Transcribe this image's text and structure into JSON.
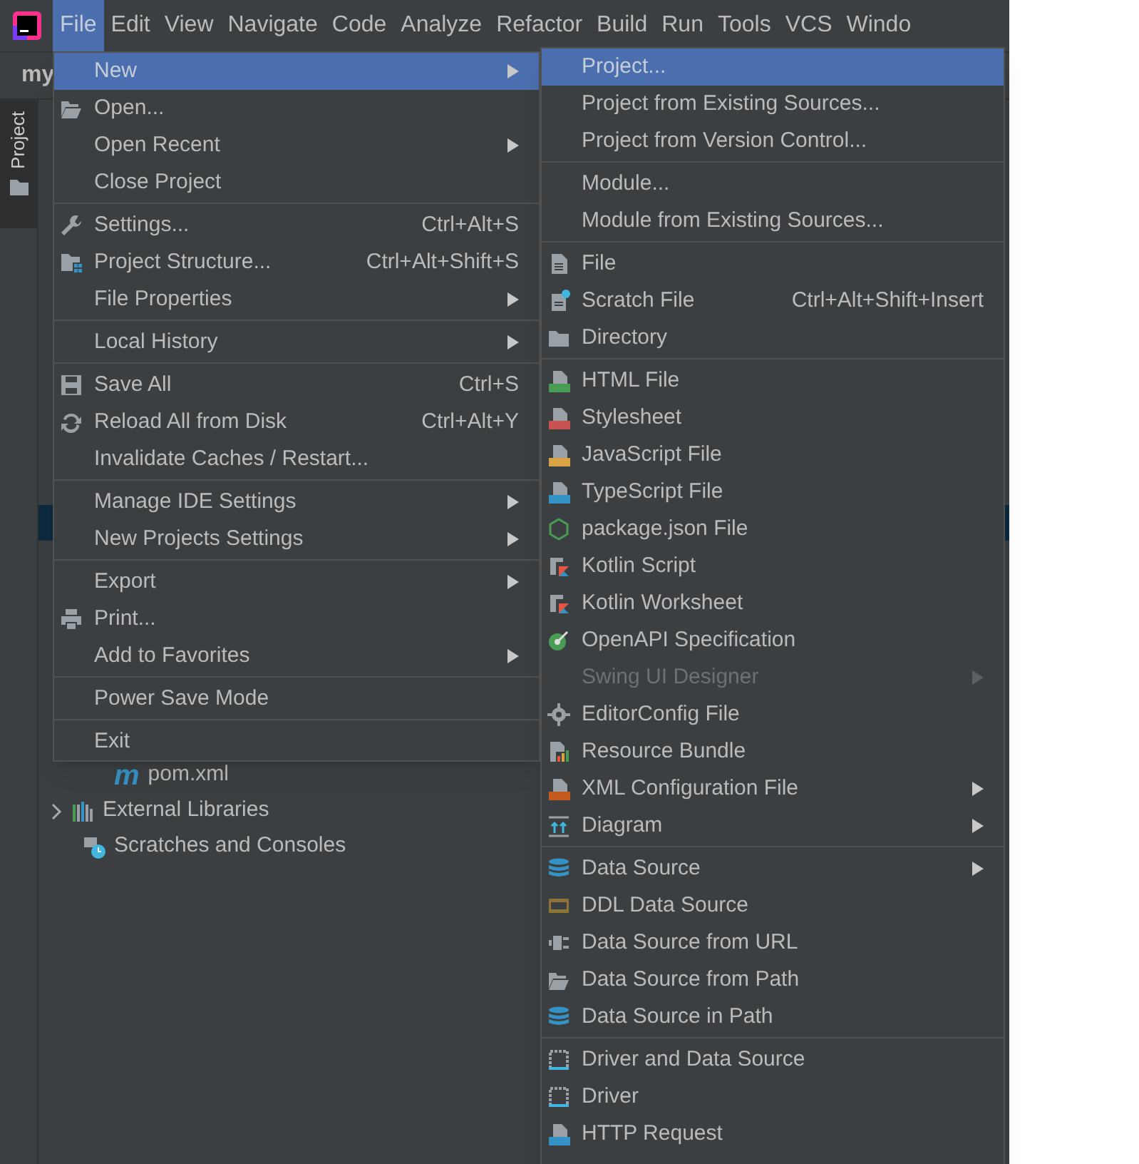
{
  "menubar": [
    {
      "label": "File",
      "selected": true
    },
    {
      "label": "Edit",
      "selected": false
    },
    {
      "label": "View",
      "selected": false
    },
    {
      "label": "Navigate",
      "selected": false
    },
    {
      "label": "Code",
      "selected": false
    },
    {
      "label": "Analyze",
      "selected": false
    },
    {
      "label": "Refactor",
      "selected": false
    },
    {
      "label": "Build",
      "selected": false
    },
    {
      "label": "Run",
      "selected": false
    },
    {
      "label": "Tools",
      "selected": false
    },
    {
      "label": "VCS",
      "selected": false
    },
    {
      "label": "Windo",
      "selected": false
    }
  ],
  "project_title": "my",
  "tool_tab": {
    "label": "Project"
  },
  "tree": [
    {
      "kind": "maven",
      "badge": "m",
      "label": "pom.xml",
      "expandable": false
    },
    {
      "kind": "libraries",
      "label": "External Libraries",
      "expandable": true
    },
    {
      "kind": "scratches",
      "label": "Scratches and Consoles",
      "expandable": false
    }
  ],
  "file_menu": {
    "sections": [
      [
        {
          "kind": "none",
          "label": "New",
          "submenu": true,
          "selected": true
        },
        {
          "kind": "folder-open",
          "label": "Open...",
          "submenu": false,
          "selected": false
        },
        {
          "kind": "none",
          "label": "Open Recent",
          "submenu": true,
          "selected": false
        },
        {
          "kind": "none",
          "label": "Close Project",
          "submenu": false,
          "selected": false
        }
      ],
      [
        {
          "kind": "wrench",
          "label": "Settings...",
          "shortcut": "Ctrl+Alt+S",
          "submenu": false,
          "selected": false
        },
        {
          "kind": "structure",
          "label": "Project Structure...",
          "shortcut": "Ctrl+Alt+Shift+S",
          "submenu": false,
          "selected": false
        },
        {
          "kind": "none",
          "label": "File Properties",
          "submenu": true,
          "selected": false
        }
      ],
      [
        {
          "kind": "none",
          "label": "Local History",
          "submenu": true,
          "selected": false
        }
      ],
      [
        {
          "kind": "save",
          "label": "Save All",
          "shortcut": "Ctrl+S",
          "submenu": false,
          "selected": false
        },
        {
          "kind": "reload",
          "label": "Reload All from Disk",
          "shortcut": "Ctrl+Alt+Y",
          "submenu": false,
          "selected": false
        },
        {
          "kind": "none",
          "label": "Invalidate Caches / Restart...",
          "submenu": false,
          "selected": false
        }
      ],
      [
        {
          "kind": "none",
          "label": "Manage IDE Settings",
          "submenu": true,
          "selected": false
        },
        {
          "kind": "none",
          "label": "New Projects Settings",
          "submenu": true,
          "selected": false
        }
      ],
      [
        {
          "kind": "none",
          "label": "Export",
          "submenu": true,
          "selected": false
        },
        {
          "kind": "printer",
          "label": "Print...",
          "submenu": false,
          "selected": false
        },
        {
          "kind": "none",
          "label": "Add to Favorites",
          "submenu": true,
          "selected": false
        }
      ],
      [
        {
          "kind": "none",
          "label": "Power Save Mode",
          "submenu": false,
          "selected": false
        }
      ],
      [
        {
          "kind": "none",
          "label": "Exit",
          "submenu": false,
          "selected": false
        }
      ]
    ]
  },
  "new_submenu": {
    "sections": [
      [
        {
          "kind": "none",
          "label": "Project...",
          "submenu": false,
          "selected": true,
          "disabled": false
        },
        {
          "kind": "none",
          "label": "Project from Existing Sources...",
          "submenu": false,
          "selected": false,
          "disabled": false
        },
        {
          "kind": "none",
          "label": "Project from Version Control...",
          "submenu": false,
          "selected": false,
          "disabled": false
        }
      ],
      [
        {
          "kind": "none",
          "label": "Module...",
          "submenu": false,
          "selected": false,
          "disabled": false
        },
        {
          "kind": "none",
          "label": "Module from Existing Sources...",
          "submenu": false,
          "selected": false,
          "disabled": false
        }
      ],
      [
        {
          "kind": "file",
          "label": "File",
          "submenu": false,
          "selected": false,
          "disabled": false
        },
        {
          "kind": "scratch",
          "label": "Scratch File",
          "shortcut": "Ctrl+Alt+Shift+Insert",
          "submenu": false,
          "selected": false,
          "disabled": false
        },
        {
          "kind": "folder",
          "label": "Directory",
          "submenu": false,
          "selected": false,
          "disabled": false
        }
      ],
      [
        {
          "kind": "html",
          "label": "HTML File",
          "submenu": false,
          "selected": false,
          "disabled": false
        },
        {
          "kind": "css",
          "label": "Stylesheet",
          "submenu": false,
          "selected": false,
          "disabled": false
        },
        {
          "kind": "js",
          "label": "JavaScript File",
          "submenu": false,
          "selected": false,
          "disabled": false
        },
        {
          "kind": "ts",
          "label": "TypeScript File",
          "submenu": false,
          "selected": false,
          "disabled": false
        },
        {
          "kind": "node",
          "label": "package.json File",
          "submenu": false,
          "selected": false,
          "disabled": false
        },
        {
          "kind": "kotlin",
          "label": "Kotlin Script",
          "submenu": false,
          "selected": false,
          "disabled": false
        },
        {
          "kind": "kotlin",
          "label": "Kotlin Worksheet",
          "submenu": false,
          "selected": false,
          "disabled": false
        },
        {
          "kind": "openapi",
          "label": "OpenAPI Specification",
          "submenu": false,
          "selected": false,
          "disabled": false
        },
        {
          "kind": "none",
          "label": "Swing UI Designer",
          "submenu": true,
          "selected": false,
          "disabled": true
        },
        {
          "kind": "gear",
          "label": "EditorConfig File",
          "submenu": false,
          "selected": false,
          "disabled": false
        },
        {
          "kind": "bundle",
          "label": "Resource Bundle",
          "submenu": false,
          "selected": false,
          "disabled": false
        },
        {
          "kind": "xml",
          "label": "XML Configuration File",
          "submenu": true,
          "selected": false,
          "disabled": false
        },
        {
          "kind": "diagram",
          "label": "Diagram",
          "submenu": true,
          "selected": false,
          "disabled": false
        }
      ],
      [
        {
          "kind": "database",
          "label": "Data Source",
          "submenu": true,
          "selected": false,
          "disabled": false
        },
        {
          "kind": "ddl",
          "label": "DDL Data Source",
          "submenu": false,
          "selected": false,
          "disabled": false
        },
        {
          "kind": "plug",
          "label": "Data Source from URL",
          "submenu": false,
          "selected": false,
          "disabled": false
        },
        {
          "kind": "folder-open",
          "label": "Data Source from Path",
          "submenu": false,
          "selected": false,
          "disabled": false
        },
        {
          "kind": "database",
          "label": "Data Source in Path",
          "submenu": false,
          "selected": false,
          "disabled": false
        }
      ],
      [
        {
          "kind": "driver",
          "label": "Driver and Data Source",
          "submenu": false,
          "selected": false,
          "disabled": false
        },
        {
          "kind": "driver",
          "label": "Driver",
          "submenu": false,
          "selected": false,
          "disabled": false
        },
        {
          "kind": "api",
          "label": "HTTP Request",
          "submenu": false,
          "selected": false,
          "disabled": false
        }
      ]
    ]
  }
}
